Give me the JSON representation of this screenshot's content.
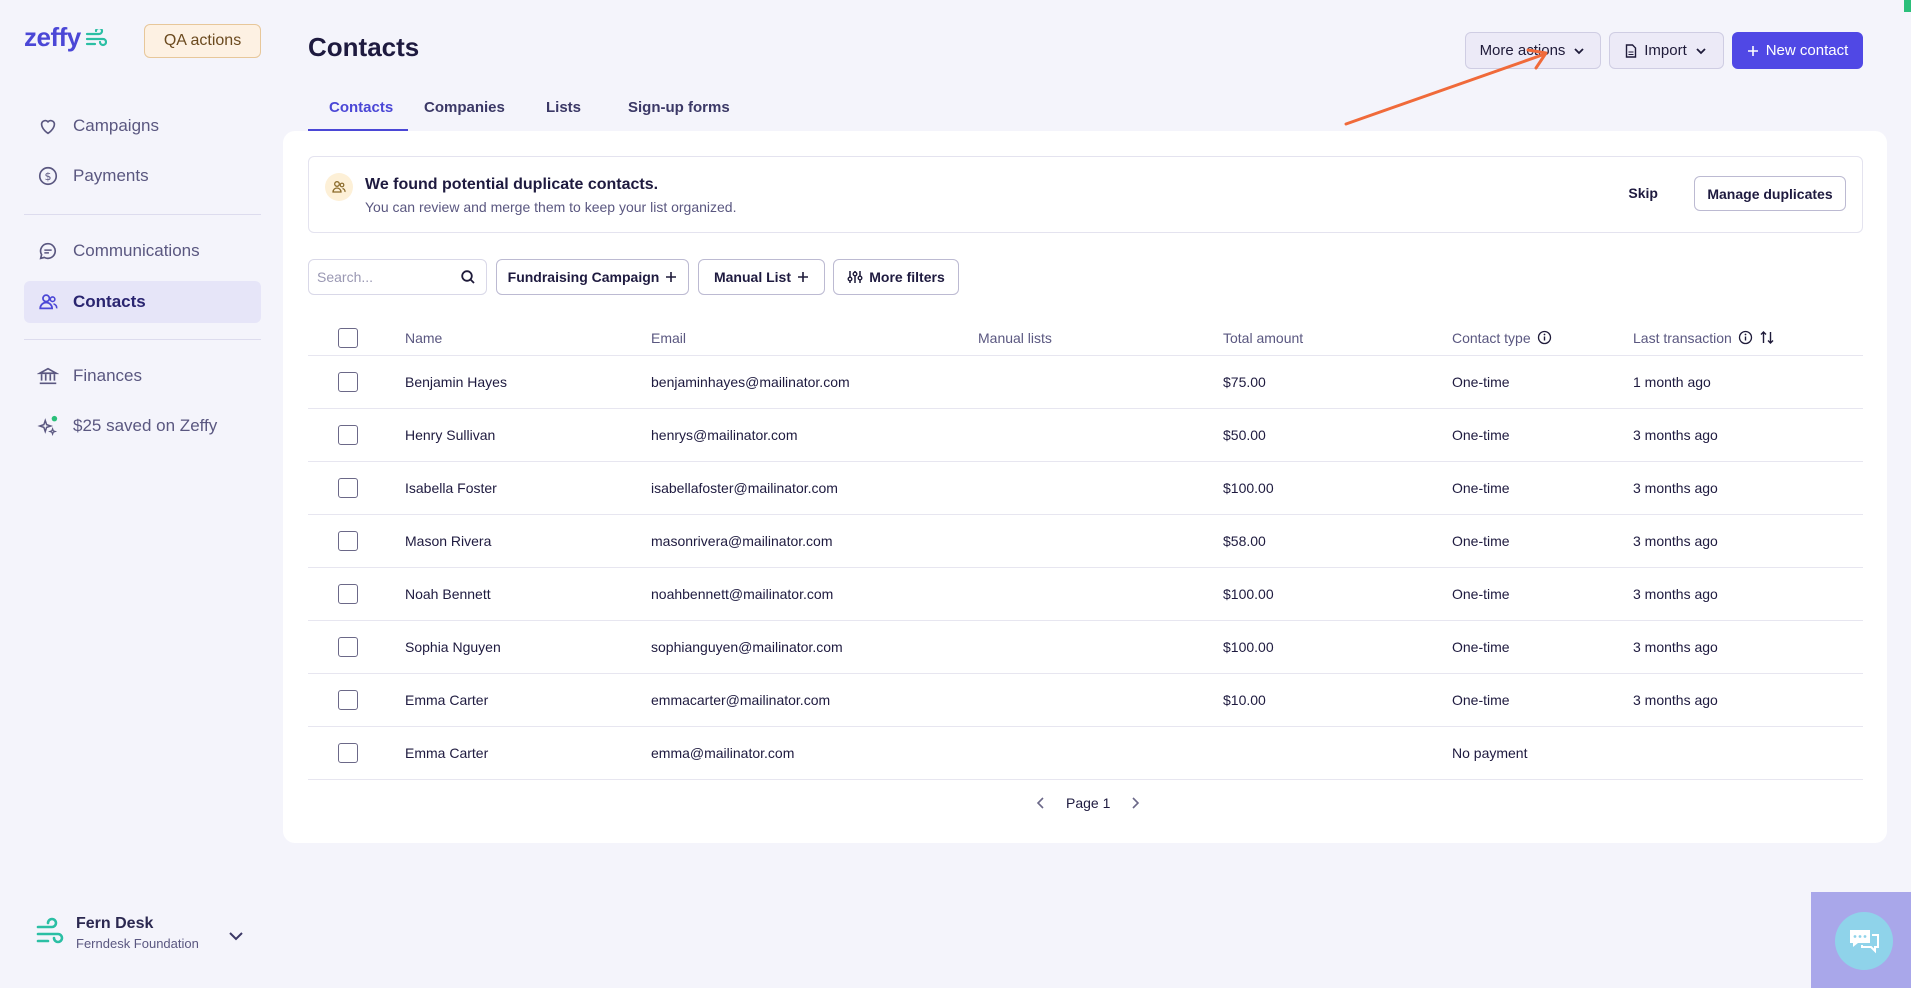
{
  "brand": {
    "logo_text": "zeffy",
    "qa_button": "QA actions"
  },
  "sidebar": {
    "items": [
      {
        "label": "Campaigns",
        "icon": "heart-icon"
      },
      {
        "label": "Payments",
        "icon": "dollar-circle-icon"
      },
      {
        "label": "Communications",
        "icon": "chat-icon"
      },
      {
        "label": "Contacts",
        "icon": "users-icon",
        "active": true
      },
      {
        "label": "Finances",
        "icon": "bank-icon"
      },
      {
        "label": "$25 saved on Zeffy",
        "icon": "sparkle-icon"
      }
    ],
    "user": {
      "name": "Fern Desk",
      "org": "Ferndesk Foundation"
    }
  },
  "header": {
    "title": "Contacts",
    "more_actions": "More actions",
    "import": "Import",
    "new_contact": "New contact"
  },
  "tabs": [
    {
      "label": "Contacts",
      "active": true
    },
    {
      "label": "Companies"
    },
    {
      "label": "Lists"
    },
    {
      "label": "Sign-up forms"
    }
  ],
  "banner": {
    "title": "We found potential duplicate contacts.",
    "subtitle": "You can review and merge them to keep your list organized.",
    "skip": "Skip",
    "manage": "Manage duplicates"
  },
  "filters": {
    "search_placeholder": "Search...",
    "campaign": "Fundraising Campaign",
    "manual_list": "Manual List",
    "more_filters": "More filters"
  },
  "table": {
    "columns": [
      "Name",
      "Email",
      "Manual lists",
      "Total amount",
      "Contact type",
      "Last transaction"
    ],
    "rows": [
      {
        "name": "Benjamin Hayes",
        "email": "benjaminhayes@mailinator.com",
        "lists": "",
        "amount": "$75.00",
        "type": "One-time",
        "last": "1 month ago"
      },
      {
        "name": "Henry Sullivan",
        "email": "henrys@mailinator.com",
        "lists": "",
        "amount": "$50.00",
        "type": "One-time",
        "last": "3 months ago"
      },
      {
        "name": "Isabella Foster",
        "email": "isabellafoster@mailinator.com",
        "lists": "",
        "amount": "$100.00",
        "type": "One-time",
        "last": "3 months ago"
      },
      {
        "name": "Mason Rivera",
        "email": "masonrivera@mailinator.com",
        "lists": "",
        "amount": "$58.00",
        "type": "One-time",
        "last": "3 months ago"
      },
      {
        "name": "Noah Bennett",
        "email": "noahbennett@mailinator.com",
        "lists": "",
        "amount": "$100.00",
        "type": "One-time",
        "last": "3 months ago"
      },
      {
        "name": "Sophia Nguyen",
        "email": "sophianguyen@mailinator.com",
        "lists": "",
        "amount": "$100.00",
        "type": "One-time",
        "last": "3 months ago"
      },
      {
        "name": "Emma Carter",
        "email": "emmacarter@mailinator.com",
        "lists": "",
        "amount": "$10.00",
        "type": "One-time",
        "last": "3 months ago"
      },
      {
        "name": "Emma Carter",
        "email": "emma@mailinator.com",
        "lists": "",
        "amount": "",
        "type": "No payment",
        "last": ""
      }
    ]
  },
  "pager": {
    "label": "Page 1"
  },
  "colors": {
    "accent": "#5048e5",
    "annotation_arrow": "#f06a3a"
  }
}
